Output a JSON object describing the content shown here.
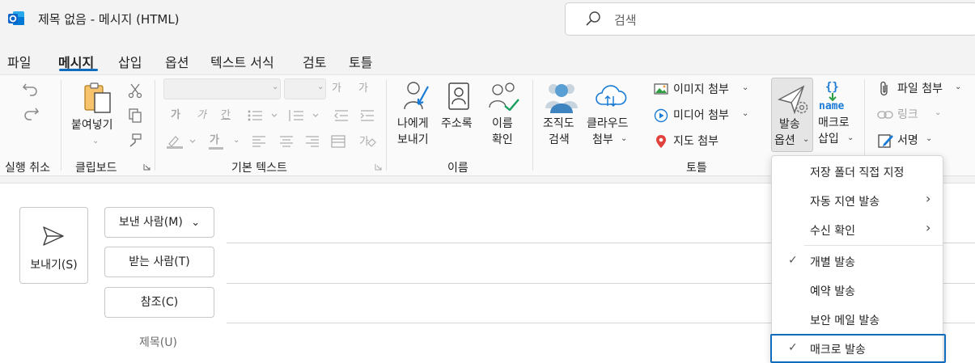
{
  "window": {
    "title": "제목 없음  -  메시지 (HTML)",
    "search_placeholder": "검색"
  },
  "menu_tabs": [
    "파일",
    "메시지",
    "삽입",
    "옵션",
    "텍스트 서식",
    "검토",
    "토틀"
  ],
  "active_tab": "메시지",
  "ribbon": {
    "undo_group": "실행 취소",
    "clipboard": {
      "paste": "붙여넣기",
      "group": "클립보드"
    },
    "basic_text": {
      "group": "기본 텍스트",
      "bold": "가",
      "italic": "가",
      "underline": "간",
      "font_color": "가",
      "size_up": "가",
      "size_down": "가"
    },
    "names": {
      "send_to_self_1": "나에게",
      "send_to_self_2": "보내기",
      "address_book": "주소록",
      "check_names_1": "이름",
      "check_names_2": "확인",
      "group": "이름"
    },
    "tools": {
      "org_search_1": "조직도",
      "org_search_2": "검색",
      "cloud_attach_1": "클라우드",
      "cloud_attach_2": "첨부",
      "image_attach": "이미지 첨부",
      "media_attach": "미디어 첨부",
      "map_attach": "지도 첨부",
      "send_options_1": "발송",
      "send_options_2": "옵션",
      "macro_insert_1": "매크로",
      "macro_insert_2": "삽입",
      "macro_icon_text": "name",
      "group": "토틀"
    },
    "attach": {
      "file_attach": "파일 첨부",
      "link": "링크",
      "signature": "서명"
    }
  },
  "compose": {
    "send_button": "보내기(S)",
    "from_button": "보낸 사람(M)",
    "to_button": "받는 사람(T)",
    "cc_button": "참조(C)",
    "subject_label": "제목(U)"
  },
  "send_options_menu": [
    {
      "label": "저장 폴더 직접 지정",
      "checked": false,
      "submenu": false
    },
    {
      "label": "자동 지연 발송",
      "checked": false,
      "submenu": true
    },
    {
      "label": "수신 확인",
      "checked": false,
      "submenu": true
    },
    {
      "label": "개별 발송",
      "checked": true,
      "submenu": false
    },
    {
      "label": "예약 발송",
      "checked": false,
      "submenu": false
    },
    {
      "label": "보안 메일 발송",
      "checked": false,
      "submenu": false
    },
    {
      "label": "매크로 발송",
      "checked": true,
      "submenu": false
    }
  ],
  "colors": {
    "accent": "#0f6cbd",
    "outlook_blue": "#0a64c8"
  }
}
